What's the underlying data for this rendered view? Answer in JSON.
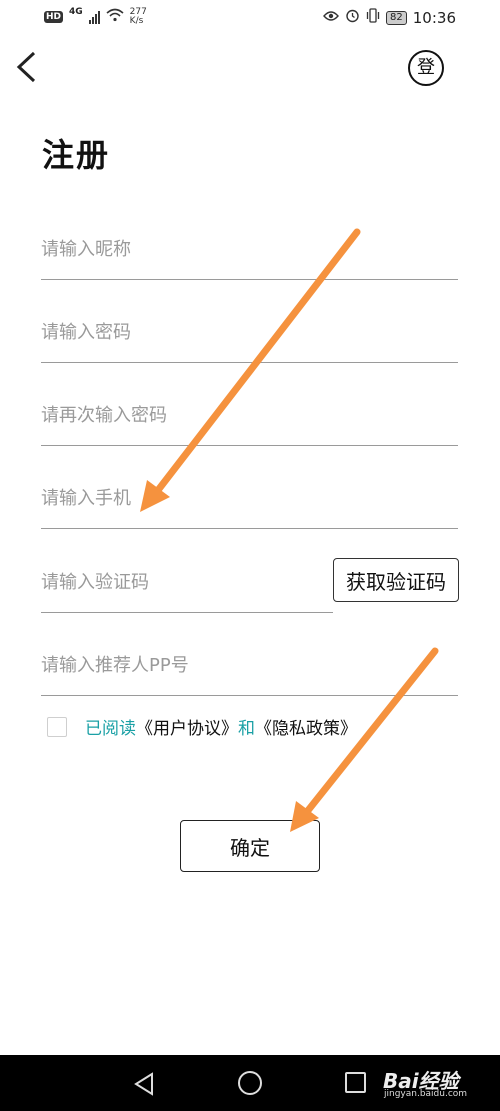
{
  "status_bar": {
    "hd": "HD",
    "network": "4G",
    "speed_value": "277",
    "speed_unit": "K/s",
    "battery": "82",
    "time": "10:36"
  },
  "header": {
    "back_icon": "chevron-left-icon",
    "login_label": "登"
  },
  "title": "注册",
  "form": {
    "nickname_placeholder": "请输入昵称",
    "password_placeholder": "请输入密码",
    "confirm_password_placeholder": "请再次输入密码",
    "phone_placeholder": "请输入手机",
    "code_placeholder": "请输入验证码",
    "get_code_label": "获取验证码",
    "referrer_placeholder": "请输入推荐人PP号"
  },
  "agreement": {
    "read_label": "已阅读",
    "user_agreement": "《用户协议》",
    "and_label": "和",
    "privacy_policy": "《隐私政策》"
  },
  "confirm_label": "确定",
  "watermark": {
    "brand": "Bai经验",
    "url": "jingyan.baidu.com"
  },
  "colors": {
    "accent_teal": "#1aa0a5",
    "arrow_orange": "#f5923e"
  }
}
